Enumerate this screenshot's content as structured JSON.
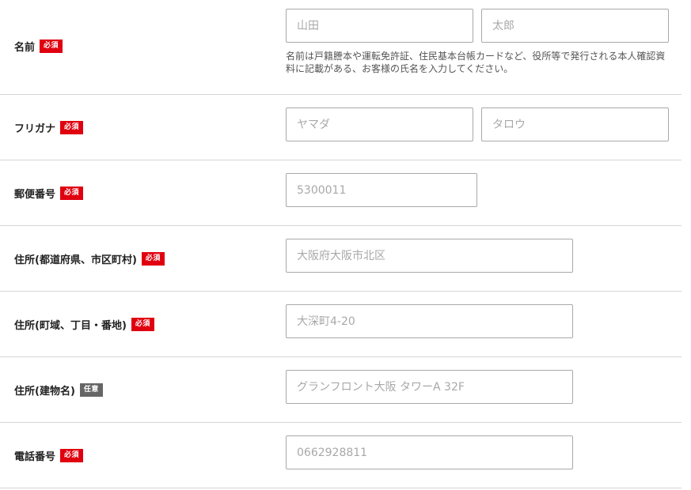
{
  "required_badge": "必須",
  "optional_badge": "任意",
  "fields": {
    "name": {
      "label": "名前",
      "last_placeholder": "山田",
      "first_placeholder": "太郎",
      "note": "名前は戸籍謄本や運転免許証、住民基本台帳カードなど、役所等で発行される本人確認資料に記載がある、お客様の氏名を入力してください。"
    },
    "furigana": {
      "label": "フリガナ",
      "last_placeholder": "ヤマダ",
      "first_placeholder": "タロウ"
    },
    "postal": {
      "label": "郵便番号",
      "placeholder": "5300011"
    },
    "address_pref_city": {
      "label": "住所(都道府県、市区町村)",
      "placeholder": "大阪府大阪市北区"
    },
    "address_town": {
      "label": "住所(町域、丁目・番地)",
      "placeholder": "大深町4-20"
    },
    "address_building": {
      "label": "住所(建物名)",
      "placeholder": "グランフロント大阪 タワーA 32F"
    },
    "phone": {
      "label": "電話番号",
      "placeholder": "0662928811"
    }
  },
  "colors": {
    "required_badge": "#e0000f",
    "optional_badge": "#666666",
    "divider": "#d6d6d6",
    "input_border": "#a9a9a9",
    "placeholder": "#a8a8a8"
  }
}
